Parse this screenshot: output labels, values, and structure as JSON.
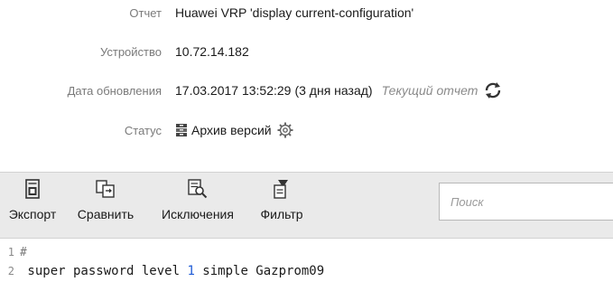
{
  "report": {
    "label": "Отчет",
    "value": "Huawei VRP 'display current-configuration'"
  },
  "device": {
    "label": "Устройство",
    "value": "10.72.14.182"
  },
  "updated": {
    "label": "Дата обновления",
    "value": "17.03.2017 13:52:29",
    "ago": "(3 дня назад)",
    "current_link": "Текущий отчет"
  },
  "status": {
    "label": "Статус",
    "value": "Архив версий"
  },
  "toolbar": {
    "export_label": "Экспорт",
    "compare_label": "Сравнить",
    "exclusions_label": "Исключения",
    "filter_label": "Фильтр",
    "search_placeholder": "Поиск"
  },
  "code": {
    "lines": [
      {
        "number": "1",
        "text": "#"
      },
      {
        "number": "2",
        "before": " super password level ",
        "level": "1",
        "after": " simple Gazprom09"
      }
    ]
  },
  "colors": {
    "toolbar_bg": "#eaeaea",
    "label_text": "#7a7a7a",
    "line_number_text": "#8a8a8a",
    "keyword_number": "#1f5bd6",
    "icon_dark": "#333333"
  },
  "icons": {
    "refresh": "refresh-icon",
    "archive": "archive-icon",
    "settings": "gear-icon",
    "export": "export-icon",
    "compare": "compare-icon",
    "exclusions": "exclusions-icon",
    "filter": "filter-icon"
  }
}
